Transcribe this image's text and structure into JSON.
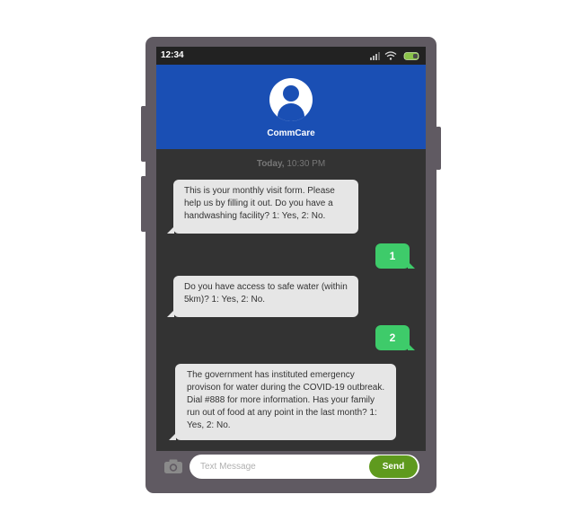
{
  "status_bar": {
    "time": "12:34",
    "icons": [
      "signal-icon",
      "wifi-icon",
      "battery-icon"
    ],
    "battery_color": "#8bc34a"
  },
  "header": {
    "title": "CommCare",
    "background": "#1a4fb4"
  },
  "conversation": {
    "timestamp_day": "Today,",
    "timestamp_time": "10:30 PM",
    "messages": [
      {
        "direction": "incoming",
        "text": "This is your monthly visit form. Please help us by filling it out. Do you have a handwashing facility? 1: Yes, 2: No."
      },
      {
        "direction": "outgoing",
        "text": "1"
      },
      {
        "direction": "incoming",
        "text": "Do you have access to safe water (within 5km)? 1: Yes, 2: No."
      },
      {
        "direction": "outgoing",
        "text": "2"
      },
      {
        "direction": "incoming",
        "text": "The government has instituted emergency provison for water during the COVID-19 outbreak. Dial #888 for more information. Has your family run out of food at any point in the last month?  1: Yes, 2: No."
      }
    ]
  },
  "composer": {
    "placeholder": "Text Message",
    "send_label": "Send",
    "send_color": "#5f9a1e",
    "camera_icon": "camera-icon"
  }
}
